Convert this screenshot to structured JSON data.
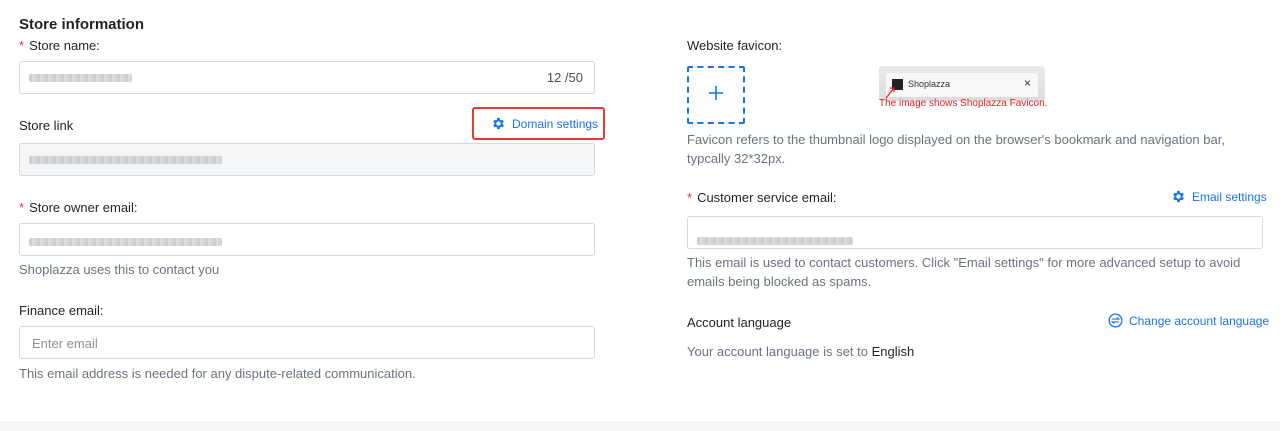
{
  "section": {
    "title": "Store information"
  },
  "store_name": {
    "label": "Store name:",
    "counter": "12 /50"
  },
  "store_link": {
    "label": "Store link",
    "domain_settings": "Domain settings"
  },
  "owner_email": {
    "label": "Store owner email:",
    "help": "Shoplazza uses this to contact you"
  },
  "finance_email": {
    "label": "Finance email:",
    "placeholder": "Enter email",
    "help": "This email address is needed for any dispute-related communication."
  },
  "favicon": {
    "label": "Website favicon:",
    "preview_tab_title": "Shoplazza",
    "preview_close": "×",
    "annotation": "The image shows Shoplazza Favicon.",
    "help": "Favicon refers to the thumbnail logo displayed on the browser's bookmark and navigation bar, typcally 32*32px."
  },
  "customer_email": {
    "label": "Customer service email:",
    "settings_link": "Email settings",
    "help": "This email is used to contact customers. Click \"Email settings\" for more advanced setup to avoid emails being blocked as spams."
  },
  "language": {
    "label": "Account language",
    "change_link": "Change account language",
    "status_prefix": "Your account language is set to",
    "value": "English"
  },
  "colors": {
    "accent": "#1a73e8",
    "required": "#e53935",
    "highlight": "#e53935"
  },
  "icons": [
    "gear-icon",
    "plus-icon",
    "language-switch-icon",
    "favicon-icon",
    "close-icon",
    "arrow-icon"
  ]
}
